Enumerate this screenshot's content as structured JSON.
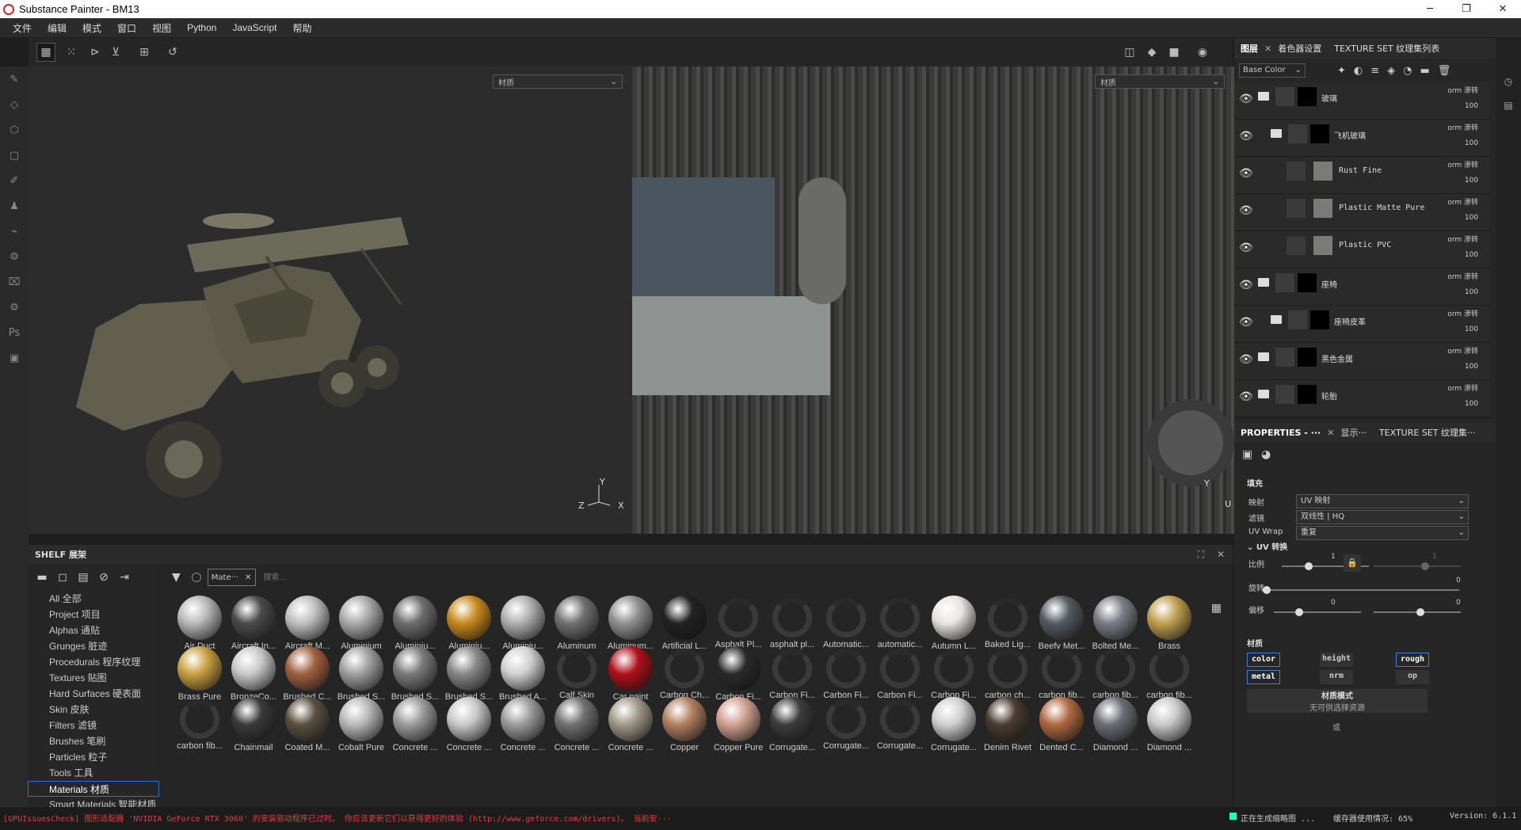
{
  "window": {
    "title": "Substance Painter - BM13"
  },
  "menu": [
    "文件",
    "编辑",
    "模式",
    "窗口",
    "视图",
    "Python",
    "JavaScript",
    "帮助"
  ],
  "viewport3d": {
    "material_dropdown": "材质",
    "axis_x": "X",
    "axis_y": "Y",
    "axis_z": "Z"
  },
  "viewport2d": {
    "material_dropdown": "材质",
    "axis_y": "Y",
    "axis_u": "U"
  },
  "shelf": {
    "title": "SHELF 展架",
    "filter_tag": "Mate···",
    "search_placeholder": "搜索...",
    "categories": [
      "All 全部",
      "Project 项目",
      "Alphas 通贴",
      "Grunges 脏迹",
      "Procedurals 程序纹理",
      "Textures 贴图",
      "Hard Surfaces 硬表面",
      "Skin 皮肤",
      "Filters 滤镜",
      "Brushes 笔刷",
      "Particles 粒子",
      "Tools 工具",
      "Materials 材质",
      "Smart Materials 智能材质"
    ],
    "selected_category": "Materials 材质",
    "materials": [
      {
        "name": "Air Duct",
        "style": "ball",
        "color": "#b8b8b8"
      },
      {
        "name": "Aircraft In...",
        "style": "ball",
        "color": "#4a4a4a"
      },
      {
        "name": "Aircraft M...",
        "style": "ball",
        "color": "#c0c0c0"
      },
      {
        "name": "Aluminium",
        "style": "ball",
        "color": "#aaaaaa"
      },
      {
        "name": "Aluminiu...",
        "style": "ball",
        "color": "#6e6e6e"
      },
      {
        "name": "Aluminiu...",
        "style": "ball",
        "color": "#c88a1e"
      },
      {
        "name": "Aluminiu...",
        "style": "ball",
        "color": "#b0b0b0"
      },
      {
        "name": "Aluminum",
        "style": "ball",
        "color": "#707070"
      },
      {
        "name": "Aluminum...",
        "style": "ball",
        "color": "#909090"
      },
      {
        "name": "Artificial L...",
        "style": "ball",
        "color": "#222222"
      },
      {
        "name": "Asphalt Pl...",
        "style": "spin",
        "color": ""
      },
      {
        "name": "asphalt pl...",
        "style": "spin",
        "color": ""
      },
      {
        "name": "Automatic...",
        "style": "spin",
        "color": ""
      },
      {
        "name": "automatic...",
        "style": "spin",
        "color": ""
      },
      {
        "name": "Autumn L...",
        "style": "ball",
        "color": "#e8e4e0"
      },
      {
        "name": "Baked Lig...",
        "style": "spin",
        "color": ""
      },
      {
        "name": "Beefy Met...",
        "style": "ball",
        "color": "#555a60"
      },
      {
        "name": "Bolted Me...",
        "style": "ball",
        "color": "#7a7e84"
      },
      {
        "name": "Brass",
        "style": "ball",
        "color": "#c0a050"
      },
      {
        "name": "Brass Pure",
        "style": "ball",
        "color": "#c8a040"
      },
      {
        "name": "BronzeCo...",
        "style": "ball",
        "color": "#c8c8c8"
      },
      {
        "name": "Brushed C...",
        "style": "ball",
        "color": "#a06040"
      },
      {
        "name": "Brushed S...",
        "style": "ball",
        "color": "#a0a0a0"
      },
      {
        "name": "Brushed S...",
        "style": "ball",
        "color": "#7a7a7a"
      },
      {
        "name": "Brushed S...",
        "style": "ball",
        "color": "#888888"
      },
      {
        "name": "Brushed A...",
        "style": "ball",
        "color": "#d0d0d0"
      },
      {
        "name": "Calf Skin",
        "style": "spin",
        "color": ""
      },
      {
        "name": "Car paint",
        "style": "ball",
        "color": "#b0101a"
      },
      {
        "name": "Carbon Ch...",
        "style": "spin",
        "color": ""
      },
      {
        "name": "Carbon Fi...",
        "style": "ball",
        "color": "#2a2a2a"
      },
      {
        "name": "Carbon Fi...",
        "style": "spin",
        "color": ""
      },
      {
        "name": "Carbon Fi...",
        "style": "spin",
        "color": ""
      },
      {
        "name": "Carbon Fi...",
        "style": "spin",
        "color": ""
      },
      {
        "name": "Carbon Fi...",
        "style": "spin",
        "color": ""
      },
      {
        "name": "carbon ch...",
        "style": "spin",
        "color": ""
      },
      {
        "name": "carbon fib...",
        "style": "spin",
        "color": ""
      },
      {
        "name": "carbon fib...",
        "style": "spin",
        "color": ""
      },
      {
        "name": "carbon fib...",
        "style": "spin",
        "color": ""
      },
      {
        "name": "carbon fib...",
        "style": "spin",
        "color": ""
      },
      {
        "name": "Chainmail",
        "style": "ball",
        "color": "#3a3a3a"
      },
      {
        "name": "Coated M...",
        "style": "ball",
        "color": "#5a5040"
      },
      {
        "name": "Cobalt Pure",
        "style": "ball",
        "color": "#b8b8b8"
      },
      {
        "name": "Concrete ...",
        "style": "ball",
        "color": "#9a9a9a"
      },
      {
        "name": "Concrete ...",
        "style": "ball",
        "color": "#c8c8c8"
      },
      {
        "name": "Concrete ...",
        "style": "ball",
        "color": "#9c9c9c"
      },
      {
        "name": "Concrete ...",
        "style": "ball",
        "color": "#707070"
      },
      {
        "name": "Concrete ...",
        "style": "ball",
        "color": "#a09888"
      },
      {
        "name": "Copper",
        "style": "ball",
        "color": "#b08060"
      },
      {
        "name": "Copper Pure",
        "style": "ball",
        "color": "#d0a090"
      },
      {
        "name": "Corrugate...",
        "style": "ball",
        "color": "#3c3c3c"
      },
      {
        "name": "Corrugate...",
        "style": "spin",
        "color": ""
      },
      {
        "name": "Corrugate...",
        "style": "spin",
        "color": ""
      },
      {
        "name": "Corrugate...",
        "style": "ball",
        "color": "#d0d0d0"
      },
      {
        "name": "Denim Rivet",
        "style": "ball",
        "color": "#4a3c30"
      },
      {
        "name": "Dented C...",
        "style": "ball",
        "color": "#b06840"
      },
      {
        "name": "Diamond ...",
        "style": "ball",
        "color": "#6a6e74"
      },
      {
        "name": "Diamond ...",
        "style": "ball",
        "color": "#c8c8c8"
      }
    ]
  },
  "layers": {
    "tabs": [
      "图层",
      "着色器设置",
      "TEXTURE SET 纹理集列表"
    ],
    "channel": "Base Color",
    "items": [
      {
        "name": "玻璃",
        "blend": "orm 渗转",
        "opacity": "100",
        "kind": "folder"
      },
      {
        "name": "飞机玻璃",
        "blend": "orm 渗转",
        "opacity": "100",
        "kind": "folder"
      },
      {
        "name": "Rust Fine",
        "blend": "orm 渗转",
        "opacity": "100",
        "kind": "fill"
      },
      {
        "name": "Plastic Matte Pure",
        "blend": "orm 渗转",
        "opacity": "100",
        "kind": "fill"
      },
      {
        "name": "Plastic PVC",
        "blend": "orm 渗转",
        "opacity": "100",
        "kind": "fill"
      },
      {
        "name": "座椅",
        "blend": "orm 渗转",
        "opacity": "100",
        "kind": "folder"
      },
      {
        "name": "座椅皮革",
        "blend": "orm 渗转",
        "opacity": "100",
        "kind": "folder"
      },
      {
        "name": "黑色金属",
        "blend": "orm 渗转",
        "opacity": "100",
        "kind": "folder"
      },
      {
        "name": "轮胎",
        "blend": "orm 渗转",
        "opacity": "100",
        "kind": "folder"
      }
    ]
  },
  "properties": {
    "tabs": [
      "PROPERTIES - ···",
      "显示···",
      "TEXTURE SET 纹理集···"
    ],
    "section": "填充",
    "mapping_label": "映射",
    "mapping_value": "UV 映射",
    "filter_label": "滤镜",
    "filter_value": "双线性 | HQ",
    "wrap_label": "UV Wrap",
    "wrap_value": "重复",
    "uv_transform": "UV 转换",
    "scale_label": "比例",
    "scale_value": "1",
    "scale_value2": "1",
    "rotation_label": "旋转",
    "rotation_value": "0",
    "offset_label": "偏移",
    "offset_value_u": "0",
    "offset_value_v": "0",
    "material_section": "材质",
    "channels": {
      "color": "color",
      "height": "height",
      "rough": "rough",
      "metal": "metal",
      "nrm": "nrm",
      "op": "op"
    },
    "material_mode_title": "材质模式",
    "material_mode_sub": "无可供选择资源",
    "or_text": "或"
  },
  "status": {
    "error": "[GPUIssuesCheck] 图形适配器 'NVIDIA GeForce RTX 3060' 的安装驱动程序已过时。 你应该更新它们以获得更好的体验 (http://www.geforce.com/drivers)。 当前安···",
    "generating": "正在生成缩略图 ...",
    "memory": "缓存器使用情况: 65%",
    "version": "Version: 6.1.1"
  }
}
